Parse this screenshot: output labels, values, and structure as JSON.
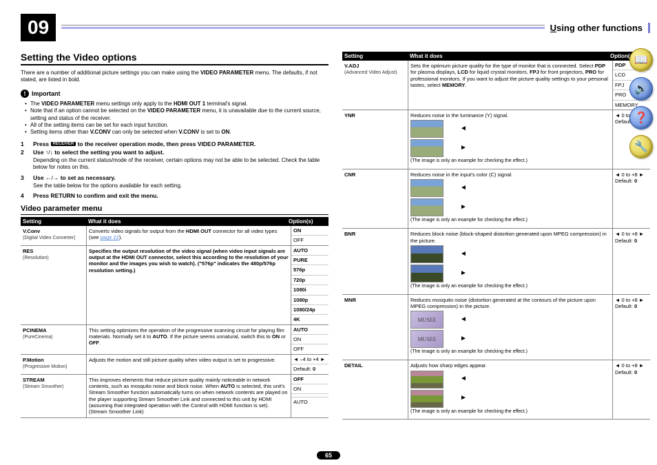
{
  "chapterNum": "09",
  "headerTitle": "sing other functions",
  "headerU": "U",
  "h1": "Setting the Video options",
  "intro": "There are a number of additional picture settings you can make using the <b>VIDEO PARAMETER</b> menu. The defaults, if not stated, are listed in bold.",
  "importantLabel": "Important",
  "bullets": [
    "The <b>VIDEO PARAMETER</b> menu settings only apply to the <b>HDMI OUT 1</b> terminal's signal.",
    "Note that if an option cannot be selected on the <b>VIDEO PARAMETER</b> menu, it is unavailable due to the current source, setting and status of the receiver.",
    "All of the setting items can be set for each input function.",
    "Setting items other than <b>V.CONV</b> can only be selected when <b>V.CONV</b> is set to <b>ON</b>."
  ],
  "steps": [
    {
      "n": "1",
      "t": "<b>Press <span class='receiver-badge'>RECEIVER</span> to the receiver operation mode, then press VIDEO PARAMETER.</b>"
    },
    {
      "n": "2",
      "t": "<b>Use </b>↑/↓<b> to select the setting you want to adjust.</b>"
    },
    {
      "n": "3",
      "t": "<b>Use </b>←/→<b> to set as necessary.</b>"
    },
    {
      "n": "4",
      "t": "<b>Press RETURN to confirm and exit the menu.</b>"
    }
  ],
  "step2note": "Depending on the current status/mode of the receiver, certain options may not be able to be selected. Check the table below for notes on this.",
  "step3note": "See the table below for the options available for each setting.",
  "h2": "Video parameter menu",
  "th": {
    "c1": "Setting",
    "c2": "What it does",
    "c3": "Option(s)"
  },
  "rows": [
    {
      "name": "V.Conv",
      "sub": "(Digital Video Converter)\n<a>",
      "desc": "Converts video signals for output from the <b>HDMI OUT</b> connector for all video types (see <span class='link'>page 22</span>).",
      "opts": [
        {
          "v": "ON",
          "b": true
        },
        {
          "v": "OFF"
        }
      ]
    },
    {
      "name": "RES",
      "sub": "(Resolution)\n<b>",
      "desc": "Specifies the output resolution of the video signal (when video input signals are output at the <b>HDMI OUT</b> connector, select this according to the resolution of your monitor and the images you wish to watch). (\"576p\" indicates the 480p/576p resolution setting.)",
      "opts": [
        {
          "v": "AUTO",
          "b": true
        },
        {
          "v": "PURE"
        },
        {
          "v": "576p"
        },
        {
          "v": "720p"
        },
        {
          "v": "1080i"
        },
        {
          "v": "1080p"
        },
        {
          "v": "1080/24p"
        },
        {
          "v": "4K"
        }
      ]
    },
    {
      "name": "PCINEMA",
      "sub": "(PureCinema)\n<c, e>",
      "desc": "This setting optimizes the operation of the progressive scanning circuit for playing film materials. Normally set it to <b>AUTO</b>. If the picture seems unnatural, switch this to <b>ON</b> or <b>OFF</b>.",
      "opts": [
        {
          "v": "AUTO",
          "b": true
        },
        {
          "v": "ON"
        },
        {
          "v": "OFF"
        }
      ]
    },
    {
      "name": "P.Motion",
      "sub": "(Progressive Motion)\n<c, e>",
      "desc": "Adjusts the motion and still picture quality when video output is set to progressive.",
      "opts": [
        {
          "v": "◄ –4 to +4 ►"
        },
        {
          "v": "Default: <b>0</b>"
        }
      ]
    },
    {
      "name": "STREAM",
      "sub": "(Stream Smoother)\n<e>",
      "desc": "This improves elements that reduce picture quality mainly noticeable in network contents, such as mosquito noise and block noise. When <b>AUTO</b> is selected, this unit's Stream Smoother function automatically turns on when network contents are played on the player supporting Stream Smoother Link and connected to this unit by HDMI (assuming that integrated operation with the Control with HDMI function is set). (Stream Smoother Link)",
      "opts": [
        {
          "v": "OFF",
          "b": true
        },
        {
          "v": "ON"
        },
        {
          "v": ""
        },
        {
          "v": "AUTO"
        }
      ]
    }
  ],
  "th2": {
    "c1": "Setting",
    "c2": "What it does",
    "c3": "Option(s)"
  },
  "rows2": [
    {
      "name": "V.ADJ",
      "sub": "(Advanced Video Adjust)",
      "desc": "Sets the optimum picture quality for the type of monitor that is connected. Select <b>PDP</b> for plasma displays, <b>LCD</b> for liquid crystal monitors, <b>FPJ</b> for front projectors, <b>PRO</b> for professional monitors. If you want to adjust the picture quality settings to your personal tastes, select <b>MEMORY</b>.",
      "opts": [
        {
          "v": "PDP",
          "b": true
        },
        {
          "v": "LCD"
        },
        {
          "v": "FPJ"
        },
        {
          "v": "PRO"
        },
        {
          "v": "MEMORY"
        }
      ],
      "plain": true
    }
  ],
  "effectRows": [
    {
      "name": "YNR",
      "sub": "<d, e>",
      "desc": "Reduces noise in the luminance (Y) signal.",
      "range": "◄ 0 to +8 ►",
      "def": "Default: <b>0</b>",
      "thumbClass": ""
    },
    {
      "name": "CNR",
      "sub": "<d, e>",
      "desc": "Reduces noise in the input's color (C) signal.",
      "range": "◄ 0 to +8 ►",
      "def": "Default: <b>0</b>",
      "thumbClass": ""
    },
    {
      "name": "BNR",
      "sub": "<d, e>",
      "desc": "Reduces block noise (block-shaped distortion generated upon MPEG compression) in the picture.",
      "range": "◄ 0 to +8 ►",
      "def": "Default: <b>0</b>",
      "thumbClass": "bnr"
    },
    {
      "name": "MNR",
      "sub": "<d, e>",
      "desc": "Reduces mosquito noise (distortion generated at the contours of the picture upon MPEG compression) in the picture.",
      "range": "◄ 0 to +8 ►",
      "def": "Default: <b>0</b>",
      "thumbClass": "mnr",
      "thumbText": "MUSEE"
    },
    {
      "name": "DETAIL",
      "sub": "<d, e>",
      "desc": "Adjusts how sharp edges appear.",
      "range": "◄ 0 to +8 ►",
      "def": "Default: <b>0</b>",
      "thumbClass": "detail"
    }
  ],
  "imgNote": "(The image is only an example for checking the effect.)",
  "pagenum": "65"
}
